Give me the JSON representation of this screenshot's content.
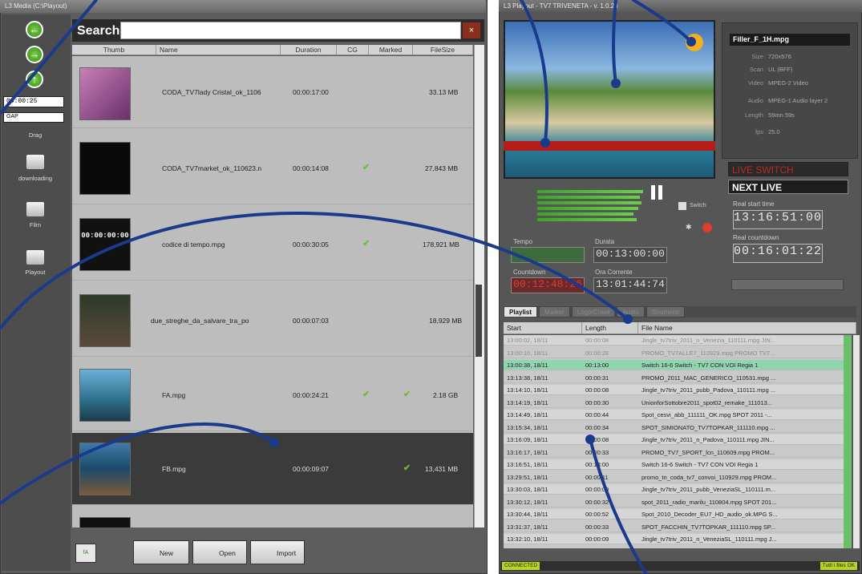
{
  "left": {
    "title": "L3 Media (C:\\Playout)",
    "sidebar": {
      "time": "00:00:25",
      "gap": "GAP",
      "drag": "Drag",
      "items": [
        "downloading",
        "Film",
        "Playout"
      ]
    },
    "search_label": "Search:",
    "search_value": "",
    "columns": [
      "Thumb",
      "Name",
      "Duration",
      "CG",
      "Marked",
      "FileSize"
    ],
    "rows": [
      {
        "name": "CODA_TV7lady Cristal_ok_1106",
        "duration": "00:00:17:00",
        "cg": false,
        "marked": false,
        "size": "33.13 MB"
      },
      {
        "name": "CODA_TV7market_ok_110623.n",
        "duration": "00:00:14:08",
        "cg": true,
        "marked": false,
        "size": "27,843 MB"
      },
      {
        "name": "codice di tempo.mpg",
        "duration": "00:00:30:05",
        "cg": true,
        "marked": false,
        "size": "178,921 MB"
      },
      {
        "name": "due_streghe_da_salvare_tra_po",
        "duration": "00:00:07:03",
        "cg": false,
        "marked": false,
        "size": "18,929 MB"
      },
      {
        "name": "FA.mpg",
        "duration": "00:00:24:21",
        "cg": true,
        "marked": true,
        "size": "2.18 GB"
      },
      {
        "name": "FB.mpg",
        "duration": "00:00:09:07",
        "cg": false,
        "marked": true,
        "size": "13,431 MB"
      }
    ],
    "timecode_thumb": "00:00:00:00",
    "buttons": {
      "new": "New",
      "open": "Open",
      "import": "Import"
    }
  },
  "right": {
    "title": "L3 Playout - TV7 TRIVENETA - v. 1.0.28",
    "file": {
      "name": "Filler_F_1H.mpg",
      "info": [
        {
          "k": "Size",
          "v": "720x576"
        },
        {
          "k": "Scan",
          "v": "UL (BFF)"
        },
        {
          "k": "Video",
          "v": "MPEG-2 Video"
        },
        {
          "k": "Audio",
          "v": "MPEG-1 Audio layer 2"
        },
        {
          "k": "Length",
          "v": "59mn 59s"
        },
        {
          "k": "fps",
          "v": "25.0"
        }
      ]
    },
    "live_switch": "LIVE SWITCH",
    "next_live": "NEXT LIVE",
    "real_start_label": "Real start time",
    "real_start": "13:16:51:00",
    "real_countdown_label": "Real countdown",
    "real_countdown": "00:16:01:22",
    "switch_label": "Switch",
    "tempo_label": "Tempo",
    "durata_label": "Durata",
    "durata": "00:13:00:00",
    "countdown_label": "Countdown",
    "countdown": "00:12:48:26",
    "ora_label": "Ora Corrente",
    "ora": "13:01:44:74",
    "tabs": [
      "Playlist",
      "Marker",
      "Logo/Crawl",
      "Audio",
      "Strumenti"
    ],
    "pcolumns": [
      "Start",
      "Length",
      "File Name"
    ],
    "playlist": [
      {
        "start": "13:00:02, 18/11",
        "len": "00:00:08",
        "file": "Jingle_tv7triv_2011_n_Venezia_110111.mpg JIN...",
        "state": "dim"
      },
      {
        "start": "13:00:10, 18/11",
        "len": "00:00:28",
        "file": "PROMO_TV7ALLE7_110929.mpg PROMO TV7...",
        "state": "dim"
      },
      {
        "start": "13:00:38, 18/11",
        "len": "00:13:00",
        "file": "Switch 16-6 Switch - TV7 CON VOI Regia 1",
        "state": "live"
      },
      {
        "start": "13:13:38, 18/11",
        "len": "00:00:31",
        "file": "PROMO_2011_MAC_GENERICO_110531.mpg ...",
        "state": ""
      },
      {
        "start": "13:14:10, 18/11",
        "len": "00:00:08",
        "file": "Jingle_tv7triv_2011_pubb_Padova_110111.mpg ...",
        "state": ""
      },
      {
        "start": "13:14:19, 18/11",
        "len": "00:00:30",
        "file": "UnionforSottobre2011_spot02_remake_111013...",
        "state": ""
      },
      {
        "start": "13:14:49, 18/11",
        "len": "00:00:44",
        "file": "Spot_cesvi_abb_111111_OK.mpg SPOT 2011 -...",
        "state": ""
      },
      {
        "start": "13:15:34, 18/11",
        "len": "00:00:34",
        "file": "SPOT_SIMIONATO_TV7TOPKAR_111110.mpg ...",
        "state": ""
      },
      {
        "start": "13:16:09, 18/11",
        "len": "00:00:08",
        "file": "Jingle_tv7triv_2011_n_Padova_110111.mpg JIN...",
        "state": ""
      },
      {
        "start": "13:16:17, 18/11",
        "len": "00:00:33",
        "file": "PROMO_TV7_SPORT_lcn_110609.mpg PROM...",
        "state": ""
      },
      {
        "start": "13:16:51, 18/11",
        "len": "00:13:00",
        "file": "Switch 16-6 Switch - TV7 CON VOI Regia 1",
        "state": ""
      },
      {
        "start": "13:29:51, 18/11",
        "len": "00:00:11",
        "file": "promo_tn_coda_tv7_convoi_110929.mpg PROM...",
        "state": ""
      },
      {
        "start": "13:30:03, 18/11",
        "len": "00:00:09",
        "file": "Jingle_tv7triv_2011_pubb_VeneziaSL_110111.m...",
        "state": ""
      },
      {
        "start": "13:30:12, 18/11",
        "len": "00:00:32",
        "file": "spot_2011_radio_marilu_110804.mpg SPOT 201...",
        "state": ""
      },
      {
        "start": "13:30:44, 18/11",
        "len": "00:00:52",
        "file": "Spot_2010_Decoder_EU7_HD_audio_ok.MPG S...",
        "state": ""
      },
      {
        "start": "13:31:37, 18/11",
        "len": "00:00:33",
        "file": "SPOT_FACCHIN_TV7TOPKAR_111110.mpg SP...",
        "state": ""
      },
      {
        "start": "13:32:10, 18/11",
        "len": "00:00:09",
        "file": "Jingle_tv7triv_2011_n_VeneziaSL_110111.mpg J...",
        "state": ""
      }
    ],
    "status_left": "CONNECTED",
    "status_right": "Tutti i files OK"
  },
  "colors": {
    "accent": "#1a3a8c",
    "live_row": "#8fd6b0",
    "check": "#66c13a"
  }
}
